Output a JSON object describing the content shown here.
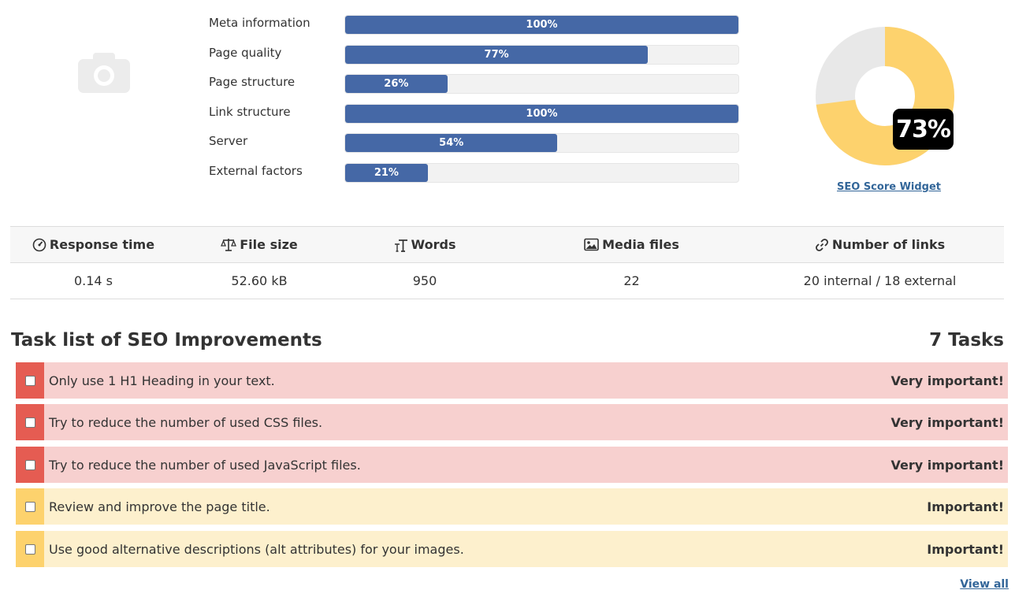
{
  "categories": [
    {
      "label": "Meta information",
      "percent": 100,
      "percent_text": "100%"
    },
    {
      "label": "Page quality",
      "percent": 77,
      "percent_text": "77%"
    },
    {
      "label": "Page structure",
      "percent": 26,
      "percent_text": "26%"
    },
    {
      "label": "Link structure",
      "percent": 100,
      "percent_text": "100%"
    },
    {
      "label": "Server",
      "percent": 54,
      "percent_text": "54%"
    },
    {
      "label": "External factors",
      "percent": 21,
      "percent_text": "21%"
    }
  ],
  "score": {
    "value": 73,
    "text": "73%",
    "fill_color": "#fdd26d",
    "rest_color": "#e8e8e8"
  },
  "widget_link": "SEO Score Widget",
  "stats": {
    "headers": [
      {
        "label": "Response time",
        "icon": "gauge-icon"
      },
      {
        "label": "File size",
        "icon": "scale-icon"
      },
      {
        "label": "Words",
        "icon": "text-size-icon"
      },
      {
        "label": "Media files",
        "icon": "image-icon"
      },
      {
        "label": "Number of links",
        "icon": "link-icon"
      }
    ],
    "values": [
      "0.14 s",
      "52.60 kB",
      "950",
      "22",
      "20 internal / 18 external"
    ]
  },
  "tasks": {
    "title": "Task list of SEO Improvements",
    "count_text": "7 Tasks",
    "items": [
      {
        "text": "Only use 1 H1 Heading in your text.",
        "priority": "Very important!",
        "level": "very"
      },
      {
        "text": "Try to reduce the number of used CSS files.",
        "priority": "Very important!",
        "level": "very"
      },
      {
        "text": "Try to reduce the number of used JavaScript files.",
        "priority": "Very important!",
        "level": "very"
      },
      {
        "text": "Review and improve the page title.",
        "priority": "Important!",
        "level": "imp"
      },
      {
        "text": "Use good alternative descriptions (alt attributes) for your images.",
        "priority": "Important!",
        "level": "imp"
      }
    ],
    "view_all": "View all"
  },
  "colors": {
    "bar": "#4568a6",
    "very_important": "#e55c52",
    "important": "#fdd26d",
    "link": "#336699"
  }
}
